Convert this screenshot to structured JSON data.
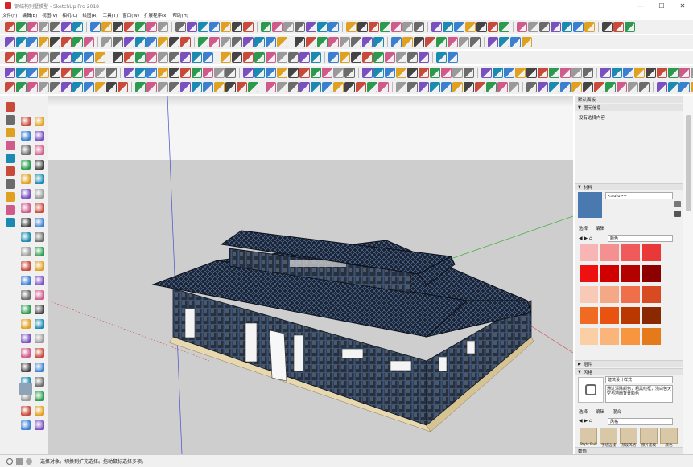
{
  "window": {
    "title": "钢结构别墅模型 - SketchUp Pro 2018",
    "minimize": "—",
    "maximize": "☐",
    "close": "✕"
  },
  "menu": [
    "文件(F)",
    "编辑(E)",
    "视图(V)",
    "相机(C)",
    "绘图(R)",
    "工具(T)",
    "窗口(W)",
    "扩展程序(x)",
    "帮助(H)"
  ],
  "panel": {
    "entity_info": {
      "header": "默认面板",
      "sub_header": "图元信息",
      "empty_text": "没有选择内容"
    },
    "materials": {
      "header": "材料",
      "material_name": "<auto>+",
      "tab_select": "选择",
      "tab_edit": "编辑",
      "category": "颜色"
    },
    "components": {
      "header": "组件"
    },
    "styles": {
      "header": "风格",
      "style_name": "建筑设计样式",
      "description": "通过清除颜色，粗黑线框，浅白色天空与地面背景颜色",
      "tab_select": "选择",
      "tab_edit": "编辑",
      "tab_mix": "混合",
      "category": "风格",
      "thumbs": [
        "Style Buil",
        "手绘边线",
        "预设风格",
        "照片建模",
        "颜色"
      ]
    },
    "tray_label": "数值"
  },
  "status": {
    "text": "选择对象。切换到扩充选择。拖动鼠标选择多项。"
  },
  "colors": {
    "swatches": [
      [
        "#f7b5b5",
        "#f59090",
        "#f05a5a",
        "#e83838"
      ],
      [
        "#ee1111",
        "#d10000",
        "#b30000",
        "#8c0000"
      ],
      [
        "#f9c9b8",
        "#f4a886",
        "#ee6f4a",
        "#d84a22"
      ],
      [
        "#f06a22",
        "#e85410",
        "#b83800",
        "#8a2800"
      ],
      [
        "#fbcfa6",
        "#f9b57a",
        "#f7963f",
        "#e47a1a"
      ]
    ],
    "material_current": "#4a79b0",
    "sky": "#f2f2f2",
    "ground": "#cccccc",
    "accent": "#2c7fd6"
  },
  "icons": {
    "toolbar_rows": 6,
    "left_tools": [
      "select",
      "eraser",
      "paint-bucket",
      "line",
      "arc",
      "rectangle",
      "circle",
      "move",
      "rotate",
      "scale",
      "push-pull",
      "offset",
      "tape-measure",
      "dimension",
      "protractor",
      "text",
      "axes",
      "orbit",
      "pan",
      "zoom",
      "zoom-extents",
      "walk",
      "look-around",
      "position-camera",
      "section-plane"
    ]
  }
}
